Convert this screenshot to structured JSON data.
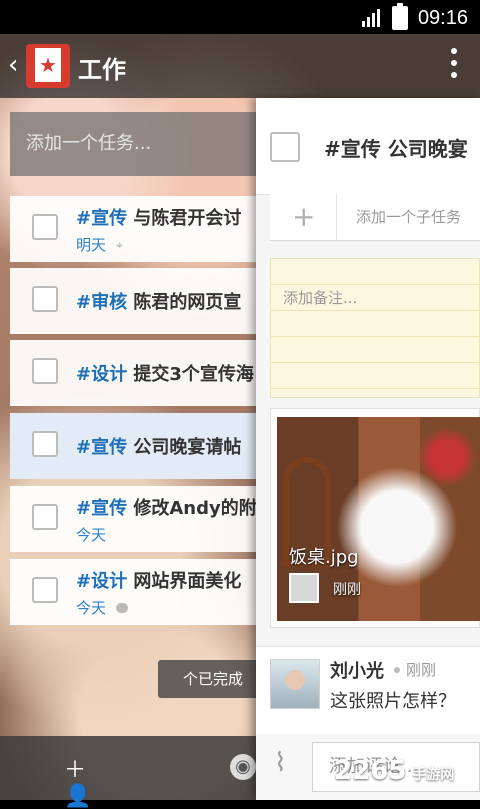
{
  "status_bar": {
    "time": "09:16"
  },
  "header": {
    "title": "工作"
  },
  "add_task_placeholder": "添加一个任务...",
  "tasks": [
    {
      "tag": "#宣传",
      "title": "与陈君开会讨",
      "meta": "明天"
    },
    {
      "tag": "#审核",
      "title": "陈君的网页宣",
      "meta": ""
    },
    {
      "tag": "#设计",
      "title": "提交3个宣传海",
      "meta": ""
    },
    {
      "tag": "#宣传",
      "title": "公司晚宴请帖",
      "meta": ""
    },
    {
      "tag": "#宣传",
      "title": "修改Andy的附",
      "meta": "今天"
    },
    {
      "tag": "#设计",
      "title": "网站界面美化",
      "meta": "今天"
    }
  ],
  "done_button": "个已完成",
  "detail": {
    "title": "#宣传 公司晚宴",
    "subtask_placeholder": "添加一个子任务",
    "note_placeholder": "添加备注...",
    "attachment": {
      "file_name": "饭桌.jpg",
      "time": "刚刚"
    },
    "comment": {
      "author": "刘小光",
      "time": "刚刚",
      "text": "这张照片怎样？"
    },
    "comment_placeholder": "添加评论..."
  },
  "watermark": {
    "brand": "2265",
    "subtitle": "手游网"
  },
  "colors": {
    "accent": "#1e6fb8",
    "logo_red": "#d63b2e",
    "note_yellow": "#fcf8df"
  }
}
